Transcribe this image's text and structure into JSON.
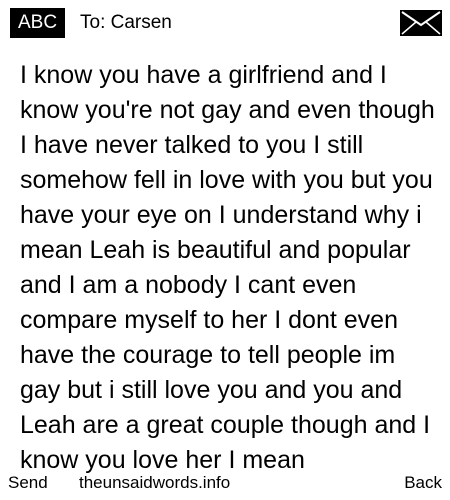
{
  "header": {
    "input_mode": "ABC",
    "recipient": "To: Carsen",
    "status_icon": "envelope-icon"
  },
  "message": {
    "body": "I know you have a girlfriend and I know you're not gay and even though I have never talked to you I still somehow fell in love with you but you have your eye on I understand why i mean Leah is beautiful and popular and I am a nobody I cant even compare myself to her I dont even have the courage to tell people im gay but i still love you and  you and Leah are a great couple though and I know you love her I mean"
  },
  "softkeys": {
    "left": "Send",
    "center": "theunsaidwords.info",
    "right": "Back"
  },
  "colors": {
    "background": "#ffffff",
    "text": "#000000",
    "badge_background": "#000000",
    "badge_text": "#ffffff"
  }
}
